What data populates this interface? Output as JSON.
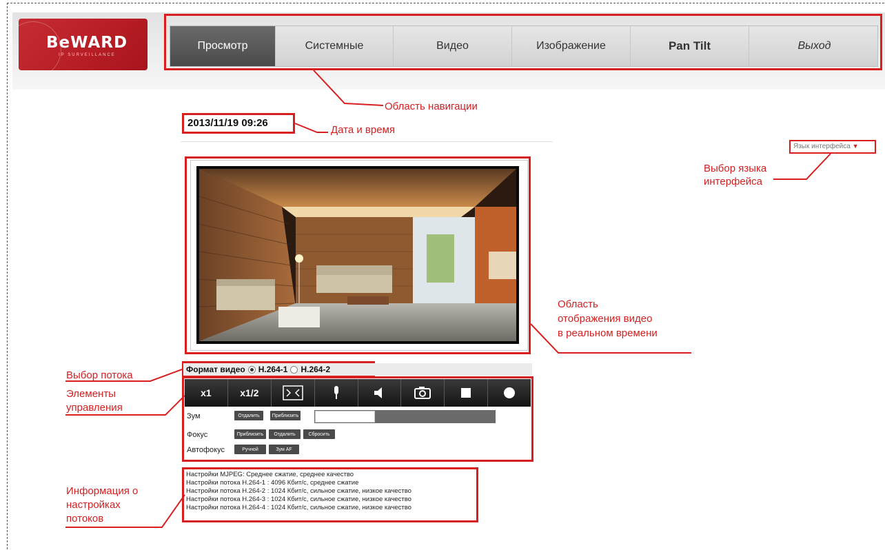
{
  "logo": {
    "brand": "BeWARD",
    "sub": "IP SURVEILLANCE"
  },
  "nav": {
    "tabs": [
      {
        "label": "Просмотр",
        "active": true
      },
      {
        "label": "Системные"
      },
      {
        "label": "Видео"
      },
      {
        "label": "Изображение"
      },
      {
        "label": "Pan Tilt"
      },
      {
        "label": "Выход"
      }
    ]
  },
  "datetime": "2013/11/19 09:26",
  "language": {
    "label": "Язык интерфейса",
    "arrow": "▼"
  },
  "stream": {
    "label": "Формат видео",
    "options": [
      {
        "label": "H.264-1",
        "selected": true
      },
      {
        "label": "H.264-2",
        "selected": false
      }
    ]
  },
  "controls": {
    "buttons": [
      {
        "label": "x1",
        "icon": "zoom-1x"
      },
      {
        "label": "x1/2",
        "icon": "zoom-half"
      },
      {
        "label": "",
        "icon": "fit-screen-icon"
      },
      {
        "label": "",
        "icon": "microphone-icon"
      },
      {
        "label": "",
        "icon": "speaker-icon"
      },
      {
        "label": "",
        "icon": "snapshot-icon"
      },
      {
        "label": "",
        "icon": "stop-icon"
      },
      {
        "label": "",
        "icon": "record-icon"
      }
    ],
    "zoom": {
      "label": "Зум",
      "out": "Отдалить",
      "in": "Приблизить",
      "level": 0.33
    },
    "focus": {
      "label": "Фокус",
      "near": "Приблизить",
      "far": "Отдалить",
      "reset": "Сбросить"
    },
    "autofocus": {
      "label": "Автофокус",
      "manual": "Ручной",
      "zoom_af": "Зум AF"
    }
  },
  "stream_info": [
    "Настройки MJPEG: Среднее сжатие, среднее качество",
    "Настройки потока H.264-1 : 4096 Кбит/с, среднее сжатие",
    "Настройки потока H.264-2 : 1024 Кбит/с, сильное сжатие, низкое качество",
    "Настройки потока H.264-3 : 1024 Кбит/с, сильное сжатие, низкое качество",
    "Настройки потока H.264-4 : 1024 Кбит/с, сильное сжатие, низкое качество"
  ],
  "annotations": {
    "nav_area": "Область навигации",
    "datetime": "Дата и время",
    "language_l1": "Выбор языка",
    "language_l2": "интерфейса",
    "video_l1": "Область",
    "video_l2": "отображения видео",
    "video_l3": "в реальном времени",
    "stream_select": "Выбор потока",
    "controls_l1": "Элементы",
    "controls_l2": "управления",
    "info_l1": "Информация о",
    "info_l2": "настройках",
    "info_l3": "потоков"
  },
  "colors": {
    "accent": "#d81e1e",
    "brand": "#c62c33",
    "nav_active": "#555555"
  }
}
